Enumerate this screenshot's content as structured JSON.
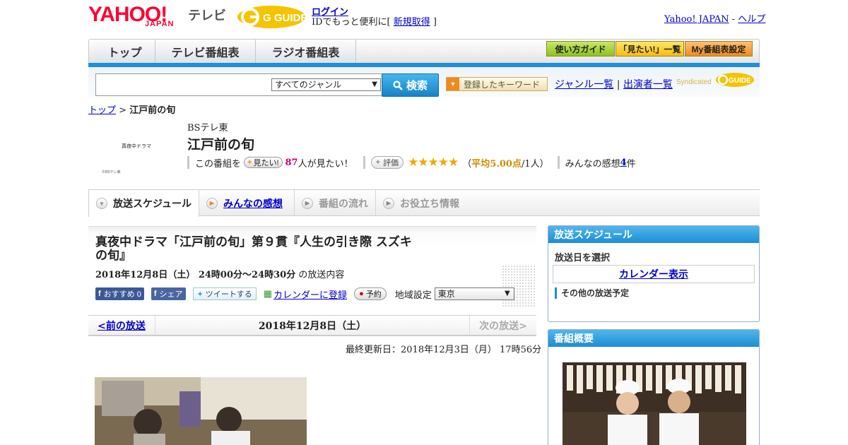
{
  "header": {
    "yahoo_logo": "YAHOO!",
    "japan_label": "JAPAN",
    "tv_label": "テレビ",
    "gguide_logo": "G GUIDE",
    "login_link": "ログイン",
    "login_sub_prefix": "IDでもっと便利に[ ",
    "register_link": "新規取得",
    "login_sub_suffix": " ]",
    "yahoo_japan_link": "Yahoo! JAPAN",
    "separator": " - ",
    "help_link": "ヘルプ"
  },
  "nav": {
    "tabs": [
      "トップ",
      "テレビ番組表",
      "ラジオ番組表"
    ],
    "guide_buttons": [
      "使い方ガイド",
      "「見たい!」一覧",
      "My番組表設定"
    ]
  },
  "search": {
    "placeholder": "",
    "genre_selected": "すべてのジャンル",
    "search_button": "検索",
    "keyword_button": "登録したキーワード",
    "genre_list_link": "ジャンル一覧",
    "divider": " | ",
    "performer_link": "出演者一覧",
    "syndicated": "Syndicated",
    "synd_logo": "GUIDE"
  },
  "breadcrumb": {
    "top": "トップ",
    "sep": " > ",
    "current": "江戸前の旬"
  },
  "program": {
    "thumb_text": "真夜中ドラマ",
    "thumb_credit": "©BSテレ東",
    "station": "BSテレ東",
    "title": "江戸前の旬",
    "want_prefix": "この番組を",
    "want_button": "見たい!",
    "want_count": "87",
    "want_suffix": "人が見たい！",
    "rate_button": "評価",
    "stars": "★★★★★",
    "avg_open": "（",
    "avg_text": "平均5.00点",
    "avg_close": "/1人）",
    "reviews_label": "みんなの感想 ",
    "reviews_count": "4",
    "reviews_unit": "件"
  },
  "subtabs": [
    "放送スケジュール",
    "みんなの感想",
    "番組の流れ",
    "お役立ち情報"
  ],
  "episode": {
    "title": "真夜中ドラマ「江戸前の旬」第９貫『人生の引き際 スズキの旬』",
    "date_time": "2018年12月8日（土） 24時00分～24時30分",
    "date_suffix": " の放送内容",
    "fb_recommend": "おすすめ 0",
    "fb_share": "シェア",
    "tweet": "ツイートする",
    "calendar_register": "カレンダーに登録",
    "reserve": "予約",
    "region_label": "地域設定",
    "region_selected": "東京"
  },
  "daynav": {
    "prev": "<前の放送",
    "current": "2018年12月8日（土）",
    "next": "次の放送>"
  },
  "updated": "最終更新日：2018年12月3日（月） 17時56分",
  "sidebar": {
    "schedule_title": "放送スケジュール",
    "select_date": "放送日を選択",
    "calendar_link": "カレンダー表示",
    "other_broadcasts": "その他の放送予定",
    "summary_title": "番組概要"
  },
  "colors": {
    "accent_blue": "#1e8fd8",
    "yahoo_red": "#ff0033",
    "star_gold": "#f0a800"
  }
}
